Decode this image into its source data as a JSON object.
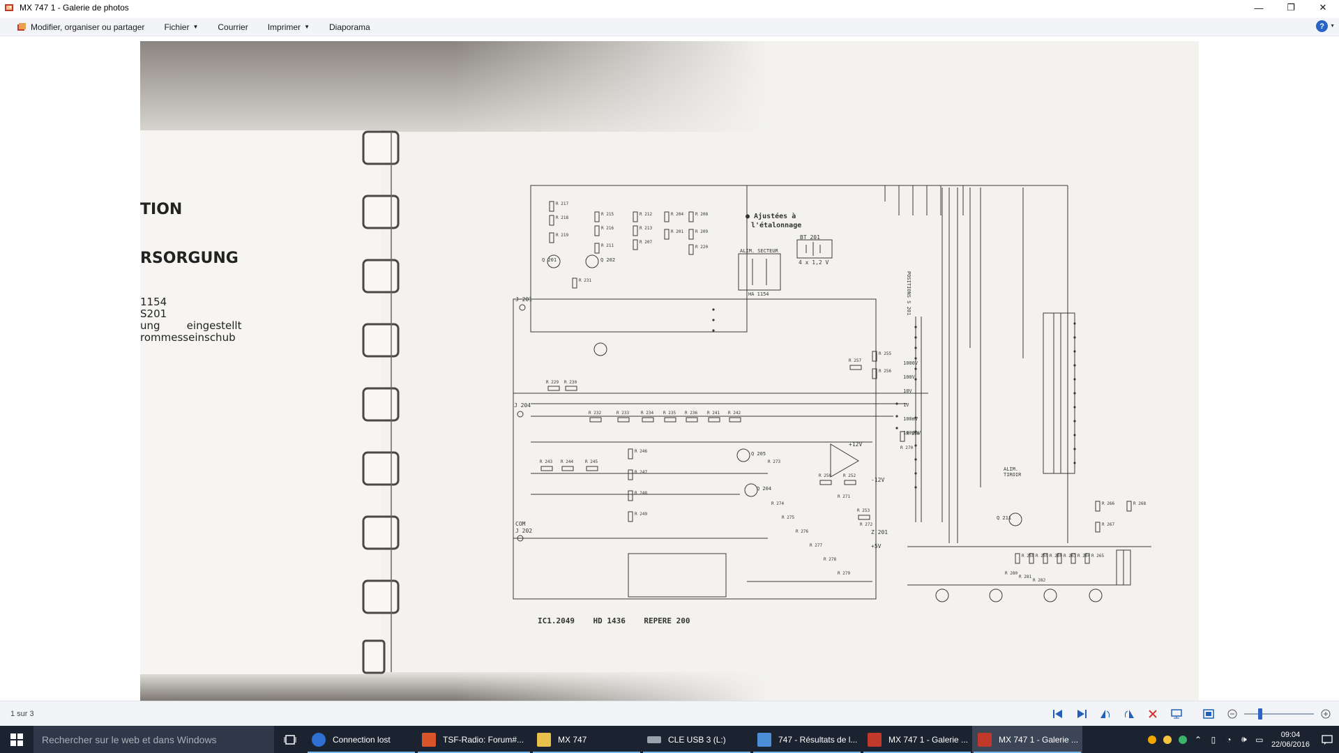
{
  "window": {
    "title": "MX 747 1 - Galerie de photos",
    "minimize_glyph": "—",
    "maximize_glyph": "❐",
    "close_glyph": "✕"
  },
  "menu": {
    "organize_label": "Modifier, organiser ou partager",
    "file_label": "Fichier",
    "mail_label": "Courrier",
    "print_label": "Imprimer",
    "slideshow_label": "Diaporama",
    "help_glyph": "?"
  },
  "document": {
    "left_page": {
      "line1": "TION",
      "line2": "RSORGUNG",
      "line3": "1154",
      "line4": "S201",
      "line5": "ung        eingestellt",
      "line6": "rommesseinschub"
    },
    "schematic": {
      "note1": "● Ajustées à",
      "note2": "l'étalonnage",
      "footer": "IC1.2049    HD 1436    REPERE 200",
      "bat_label": "BT 201",
      "bat_value": "4 x 1,2 V",
      "trafo_label": "ALIM. SECTEUR",
      "trafo_sub": "HA 1154",
      "positions_label": "POSITIONS S 201",
      "alim_tiroir": "ALIM. TIROIR",
      "com_label": "COM",
      "j202_label": "J 202",
      "j201_label": "J 201",
      "j204_label": "J 204",
      "z201_label": "Z 201",
      "plus5v": "+5V",
      "plus12v": "+12V",
      "minus12v": "-12V",
      "q201": "Q 201",
      "q202": "Q 202",
      "q204": "Q 204",
      "q205": "Q 205",
      "q211": "Q 211",
      "range_labels": [
        "1000V",
        "100V",
        "10V",
        "1V",
        "100mV",
        "1000mV"
      ],
      "res_labels": [
        "R 217",
        "R 218",
        "R 219",
        "R 215",
        "R 216",
        "R 211",
        "R 212",
        "R 213",
        "R 207",
        "R 204",
        "R 201",
        "R 208",
        "R 209",
        "R 220",
        "R 231",
        "R 229",
        "R 230",
        "R 232",
        "R 233",
        "R 234",
        "R 235",
        "R 236",
        "R 241",
        "R 242",
        "R 243",
        "R 244",
        "R 245",
        "R 246",
        "R 247",
        "R 248",
        "R 249",
        "R 250",
        "R 252",
        "R 253",
        "R 254",
        "R 255",
        "R 256",
        "R 257",
        "R 258",
        "R 259",
        "R 260",
        "R 263",
        "R 264",
        "R 265",
        "R 266",
        "R 267",
        "R 268",
        "R 270",
        "R 271",
        "R 272",
        "R 273",
        "R 274",
        "R 275",
        "R 276",
        "R 277",
        "R 278",
        "R 279",
        "R 280",
        "R 281",
        "R 282"
      ]
    }
  },
  "status": {
    "count_text": "1 sur 3"
  },
  "taskbar": {
    "search_placeholder": "Rechercher sur le web et dans Windows",
    "apps": [
      {
        "label": "Connection lost"
      },
      {
        "label": "TSF-Radio: Forum#..."
      },
      {
        "label": "MX 747"
      },
      {
        "label": "CLE USB 3 (L:)"
      },
      {
        "label": "747 - Résultats de l..."
      },
      {
        "label": "MX 747 1 - Galerie ..."
      },
      {
        "label": "MX 747 1 - Galerie ..."
      }
    ],
    "time": "09:04",
    "date": "22/06/2016"
  },
  "colors": {
    "accent": "#2a64c5",
    "taskbar": "#1b2331",
    "menubar": "#f2f4f7"
  }
}
